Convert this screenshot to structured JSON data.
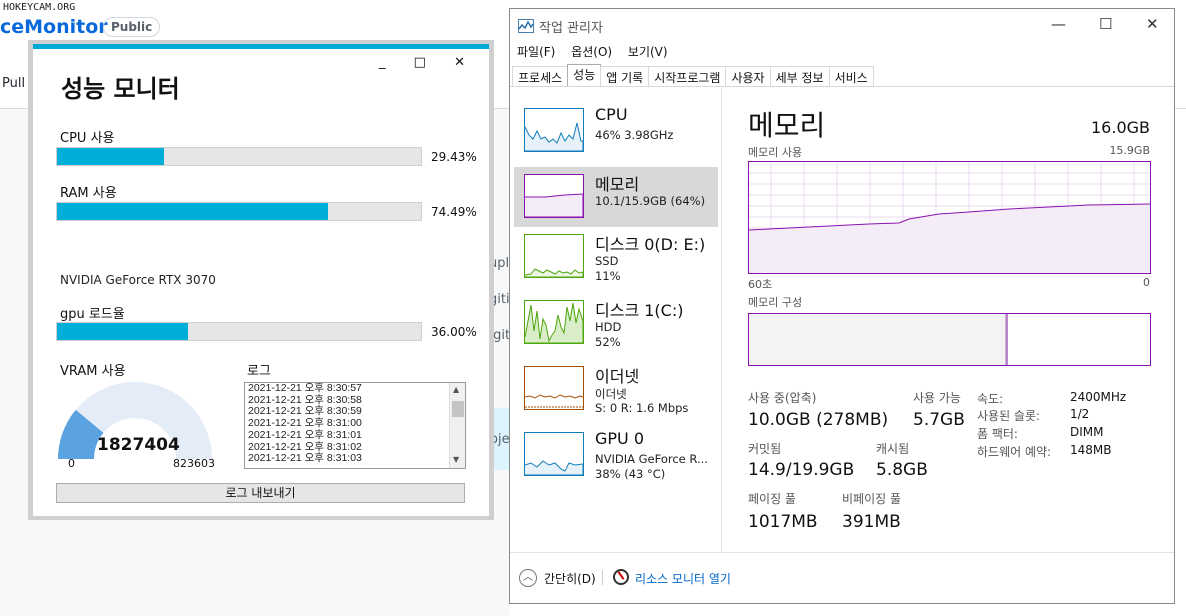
{
  "background": {
    "watermark": "HOKEYCAM.ORG",
    "repo_name": "ceMonitor",
    "visibility_badge": "Public",
    "pull_tab": "Pull r",
    "fragments": [
      "uple",
      "gitig",
      ".git",
      "roje"
    ]
  },
  "perf_monitor": {
    "title": "성능 모니터",
    "window_controls": "_ □ ✕",
    "cpu": {
      "label": "CPU 사용",
      "percent": 29.43,
      "percent_text": "29.43%"
    },
    "ram": {
      "label": "RAM 사용",
      "percent": 74.49,
      "percent_text": "74.49%"
    },
    "gpu_name": "NVIDIA GeForce RTX 3070",
    "gpu": {
      "label": "gpu 로드율",
      "percent": 36.0,
      "percent_text": "36.00%"
    },
    "vram": {
      "label": "VRAM 사용",
      "value": "1827404",
      "min": "0",
      "max": "823603",
      "fill_fraction": 0.22
    },
    "log_label": "로그",
    "log_rows": [
      "2021-12-21 오후 8:30:57",
      "2021-12-21 오후 8:30:58",
      "2021-12-21 오후 8:30:59",
      "2021-12-21 오후 8:31:00",
      "2021-12-21 오후 8:31:01",
      "2021-12-21 오후 8:31:02",
      "2021-12-21 오후 8:31:03"
    ],
    "export_button": "로그 내보내기"
  },
  "task_manager": {
    "title": "작업 관리자",
    "menu": [
      "파일(F)",
      "옵션(O)",
      "보기(V)"
    ],
    "tabs": [
      "프로세스",
      "성능",
      "앱 기록",
      "시작프로그램",
      "사용자",
      "세부 정보",
      "서비스"
    ],
    "active_tab": "성능",
    "sidebar": [
      {
        "name": "CPU",
        "line1": "46% 3.98GHz",
        "line2": "",
        "color": "#117dbb"
      },
      {
        "name": "메모리",
        "line1": "10.1/15.9GB (64%)",
        "line2": "",
        "color": "#8b12ae"
      },
      {
        "name": "디스크 0(D: E:)",
        "line1": "SSD",
        "line2": "11%",
        "color": "#4da60c"
      },
      {
        "name": "디스크 1(C:)",
        "line1": "HDD",
        "line2": "52%",
        "color": "#4da60c"
      },
      {
        "name": "이더넷",
        "line1": "이더넷",
        "line2": "S: 0  R: 1.6 Mbps",
        "color": "#a74f01"
      },
      {
        "name": "GPU 0",
        "line1": "NVIDIA GeForce R...",
        "line2": "38% (43 °C)",
        "color": "#117dbb"
      }
    ],
    "memory": {
      "title": "메모리",
      "total": "16.0GB",
      "usage_label": "메모리 사용",
      "usage_max": "15.9GB",
      "time_left": "60초",
      "time_right": "0",
      "composition_label": "메모리 구성",
      "stats": {
        "in_use_label": "사용 중(압축)",
        "in_use_value": "10.0GB (278MB)",
        "available_label": "사용 가능",
        "available_value": "5.7GB",
        "committed_label": "커밋됨",
        "committed_value": "14.9/19.9GB",
        "cached_label": "캐시됨",
        "cached_value": "5.8GB",
        "paged_label": "페이징 풀",
        "paged_value": "1017MB",
        "nonpaged_label": "비페이징 풀",
        "nonpaged_value": "391MB"
      },
      "kv": [
        {
          "key": "속도:",
          "value": "2400MHz"
        },
        {
          "key": "사용된 슬롯:",
          "value": "1/2"
        },
        {
          "key": "폼 팩터:",
          "value": "DIMM"
        },
        {
          "key": "하드웨어 예약:",
          "value": "148MB"
        }
      ]
    },
    "footer": {
      "fewer_details": "간단히(D)",
      "resource_monitor": "리소스 모니터 열기"
    }
  }
}
